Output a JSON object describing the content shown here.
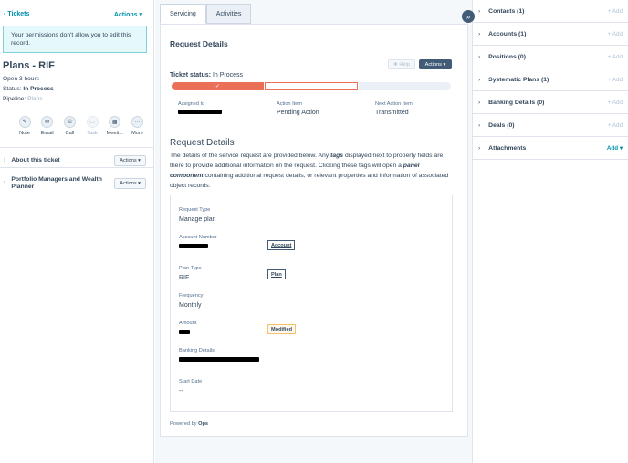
{
  "left": {
    "back_label": "Tickets",
    "actions_label": "Actions",
    "permission_notice": "Your permissions don't allow you to edit this record.",
    "record_title": "Plans - RIF",
    "open_duration": "Open 3 hours",
    "status_label": "Status:",
    "status_value": "In Process",
    "pipeline_label": "Pipeline:",
    "pipeline_value": "Plans",
    "quick_actions": [
      {
        "label": "Note",
        "icon": "note-icon",
        "glyph": "✎"
      },
      {
        "label": "Email",
        "icon": "email-icon",
        "glyph": "✉"
      },
      {
        "label": "Call",
        "icon": "call-icon",
        "glyph": "☏"
      },
      {
        "label": "Task",
        "icon": "task-icon",
        "glyph": "▭"
      },
      {
        "label": "Meeti...",
        "icon": "meeting-icon",
        "glyph": "▦"
      },
      {
        "label": "More",
        "icon": "more-icon",
        "glyph": "⋯"
      }
    ],
    "sections": [
      {
        "title": "About this ticket",
        "button": "Actions"
      },
      {
        "title": "Portfolio Managers and Wealth Planner",
        "button": "Actions"
      }
    ]
  },
  "tabs": [
    {
      "label": "Servicing"
    },
    {
      "label": "Activities"
    }
  ],
  "card": {
    "title": "Request Details",
    "help_label": "Help",
    "actions_label": "Actions",
    "ticket_status_label": "Ticket status:",
    "ticket_status_value": "In Process",
    "pipeline_check": "✓",
    "assigned_to_label": "Assigned to",
    "action_item_label": "Action Item",
    "action_item_value": "Pending Action",
    "next_action_label": "Next Action Item",
    "next_action_value": "Transmitted",
    "section_title": "Request Details",
    "description_1": "The details of the service request are provided below. Any ",
    "description_tags": "tags",
    "description_2": " displayed next to property fields are there to provide additional information on the request. Clicking these tags will open a ",
    "description_panel": "panel component",
    "description_3": " containing additional request details, or relevant properties and information of associated object records.",
    "fields": [
      {
        "label": "Request Type",
        "value": "Manage plan"
      },
      {
        "label": "Account Number",
        "value": ""
      },
      {
        "label": "Plan Type",
        "value": "RIF"
      },
      {
        "label": "Frequency",
        "value": "Monthly"
      },
      {
        "label": "Amount",
        "value": ""
      },
      {
        "label": "Banking Details",
        "value": ""
      },
      {
        "label": "Start Date",
        "value": "--"
      }
    ],
    "tags": {
      "account": "Account",
      "plan": "Plan",
      "modified": "Modified"
    },
    "powered_prefix": "Powered by",
    "powered_brand": "Ops"
  },
  "right": {
    "sections": [
      {
        "title": "Contacts (1)",
        "add": "+ Add"
      },
      {
        "title": "Accounts (1)",
        "add": "+ Add"
      },
      {
        "title": "Positions (0)",
        "add": "+ Add"
      },
      {
        "title": "Systematic Plans (1)",
        "add": "+ Add"
      },
      {
        "title": "Banking Details (0)",
        "add": "+ Add"
      },
      {
        "title": "Deals (0)",
        "add": "+ Add"
      },
      {
        "title": "Attachments",
        "add": "Add"
      }
    ]
  },
  "collapse_glyph": "»"
}
